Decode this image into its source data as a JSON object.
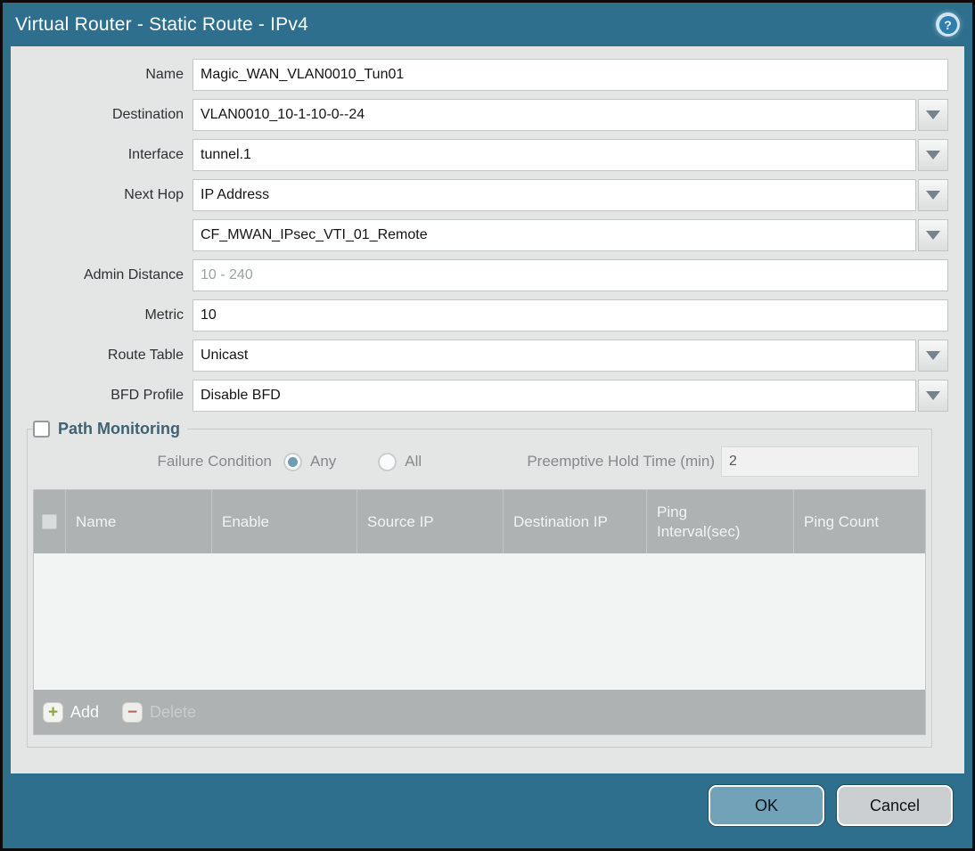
{
  "window": {
    "title": "Virtual Router - Static Route - IPv4"
  },
  "icons": {
    "help": "?",
    "add_plus": "+",
    "delete_minus": "−"
  },
  "form": {
    "name": {
      "label": "Name",
      "value": "Magic_WAN_VLAN0010_Tun01"
    },
    "destination": {
      "label": "Destination",
      "value": "VLAN0010_10-1-10-0--24"
    },
    "interface": {
      "label": "Interface",
      "value": "tunnel.1"
    },
    "next_hop": {
      "label": "Next Hop",
      "value": "IP Address"
    },
    "next_hop_address": {
      "value": "CF_MWAN_IPsec_VTI_01_Remote"
    },
    "admin_distance": {
      "label": "Admin Distance",
      "placeholder": "10 - 240"
    },
    "metric": {
      "label": "Metric",
      "value": "10"
    },
    "route_table": {
      "label": "Route Table",
      "value": "Unicast"
    },
    "bfd_profile": {
      "label": "BFD Profile",
      "value": "Disable BFD"
    }
  },
  "path_monitoring": {
    "title": "Path Monitoring",
    "enabled": false,
    "failure_condition": {
      "label": "Failure Condition",
      "options": [
        "Any",
        "All"
      ],
      "selected": "Any"
    },
    "preemptive_hold_time": {
      "label": "Preemptive Hold Time (min)",
      "value": "2"
    },
    "table": {
      "columns": [
        "Name",
        "Enable",
        "Source IP",
        "Destination IP",
        "Ping Interval(sec)",
        "Ping Count"
      ],
      "rows": []
    },
    "add_label": "Add",
    "delete_label": "Delete"
  },
  "footer": {
    "ok": "OK",
    "cancel": "Cancel"
  },
  "colors": {
    "titlebar_teal": "#2e6f8e",
    "panel_gray": "#e4e5e5",
    "table_header_gray": "#aeb2b2",
    "ok_button": "#71a2b8",
    "cancel_button": "#cbcfd2",
    "add_plus_green": "#8ca33c",
    "delete_minus_red": "#b5655f",
    "radio_selected": "#6f9db4"
  }
}
